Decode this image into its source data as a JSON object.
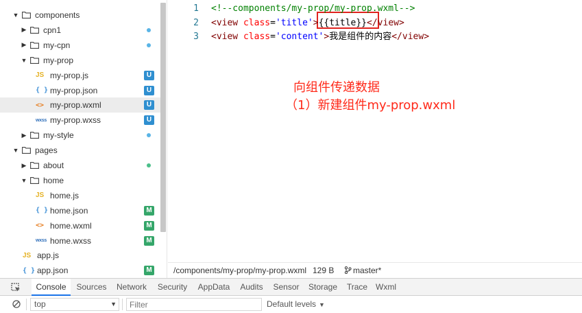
{
  "tree": [
    {
      "label": "components",
      "kind": "folder",
      "open": true,
      "depth": 0,
      "status": ""
    },
    {
      "label": "cpn1",
      "kind": "folder",
      "open": false,
      "depth": 1,
      "status": "dot-blue"
    },
    {
      "label": "my-cpn",
      "kind": "folder",
      "open": false,
      "depth": 1,
      "status": "dot-blue"
    },
    {
      "label": "my-prop",
      "kind": "folder",
      "open": true,
      "depth": 1,
      "status": ""
    },
    {
      "label": "my-prop.js",
      "kind": "js",
      "depth": 2,
      "status": "U"
    },
    {
      "label": "my-prop.json",
      "kind": "json",
      "depth": 2,
      "status": "U"
    },
    {
      "label": "my-prop.wxml",
      "kind": "wxml",
      "depth": 2,
      "status": "U",
      "selected": true
    },
    {
      "label": "my-prop.wxss",
      "kind": "wxss",
      "depth": 2,
      "status": "U"
    },
    {
      "label": "my-style",
      "kind": "folder",
      "open": false,
      "depth": 1,
      "status": "dot-blue"
    },
    {
      "label": "pages",
      "kind": "folder",
      "open": true,
      "depth": 0,
      "status": ""
    },
    {
      "label": "about",
      "kind": "folder",
      "open": false,
      "depth": 1,
      "status": "dot-green"
    },
    {
      "label": "home",
      "kind": "folder",
      "open": true,
      "depth": 1,
      "status": ""
    },
    {
      "label": "home.js",
      "kind": "js",
      "depth": 2,
      "status": ""
    },
    {
      "label": "home.json",
      "kind": "json",
      "depth": 2,
      "status": "M"
    },
    {
      "label": "home.wxml",
      "kind": "wxml",
      "depth": 2,
      "status": "M"
    },
    {
      "label": "home.wxss",
      "kind": "wxss",
      "depth": 2,
      "status": "M"
    },
    {
      "label": "app.js",
      "kind": "js",
      "depth": 0.5,
      "status": ""
    },
    {
      "label": "app.json",
      "kind": "json",
      "depth": 0.5,
      "status": "M"
    }
  ],
  "icons": {
    "js": "JS",
    "json": "{ }",
    "wxml": "<>",
    "wxss": "wxss"
  },
  "editor": {
    "lines": [
      {
        "no": "1",
        "tokens": [
          {
            "t": "<!--components/my-prop/my-prop.wxml-->",
            "c": "c-comment"
          }
        ]
      },
      {
        "no": "2",
        "tokens": [
          {
            "t": "<view ",
            "c": "c-tag"
          },
          {
            "t": "class",
            "c": "c-attr"
          },
          {
            "t": "=",
            "c": "c-text"
          },
          {
            "t": "'title'",
            "c": "c-str"
          },
          {
            "t": ">",
            "c": "c-tag"
          },
          {
            "t": "{{title}}",
            "c": "c-text"
          },
          {
            "t": "</view>",
            "c": "c-tag"
          }
        ]
      },
      {
        "no": "3",
        "tokens": [
          {
            "t": "<view ",
            "c": "c-tag"
          },
          {
            "t": "class",
            "c": "c-attr"
          },
          {
            "t": "=",
            "c": "c-text"
          },
          {
            "t": "'content'",
            "c": "c-str"
          },
          {
            "t": ">",
            "c": "c-tag"
          },
          {
            "t": "我是组件的内容",
            "c": "c-text"
          },
          {
            "t": "</view>",
            "c": "c-tag"
          }
        ]
      }
    ]
  },
  "annotation": {
    "line1": "向组件传递数据",
    "line2": "（1）新建组件my-prop.wxml"
  },
  "status": {
    "path": "/components/my-prop/my-prop.wxml",
    "size": "129 B",
    "branch": "master*"
  },
  "devtools": {
    "tabs": [
      "Console",
      "Sources",
      "Network",
      "Security",
      "AppData",
      "Audits",
      "Sensor",
      "Storage",
      "Trace",
      "Wxml"
    ],
    "active_tab": "Console",
    "context": "top",
    "filter_placeholder": "Filter",
    "levels": "Default levels"
  },
  "colors": {
    "badge_u": "#2f8fd0",
    "badge_m": "#35a66a",
    "annotation": "#ff2a1a",
    "highlight": "#e0231f"
  }
}
